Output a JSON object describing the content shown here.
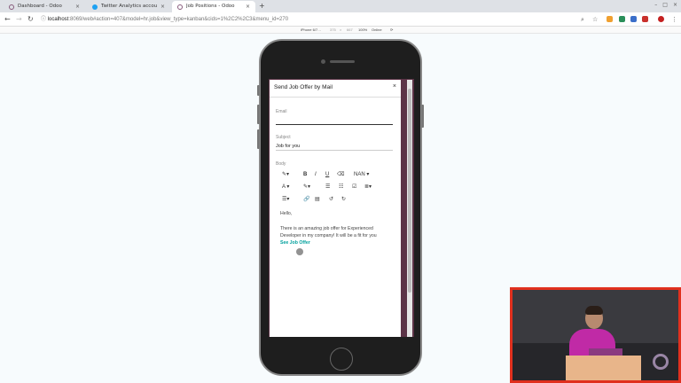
{
  "browser": {
    "tabs": [
      {
        "title": "Dashboard - Odoo",
        "icon": "odoo-icon",
        "color": "#875A7B"
      },
      {
        "title": "Twitter Analytics account ov…",
        "icon": "twitter-icon",
        "color": "#1DA1F2"
      },
      {
        "title": "Job Positions - Odoo",
        "icon": "odoo-icon",
        "color": "#875A7B"
      }
    ],
    "url_host": "localhost",
    "url_path": ":8069/web#action=407&model=hr.job&view_type=kanban&cids=1%2C2%2C3&menu_id=270"
  },
  "devtools": {
    "device": "iPhone 6/7…",
    "width": "375",
    "height": "667",
    "zoom": "100%",
    "throttle": "Online"
  },
  "modal": {
    "title": "Send Job Offer by Mail",
    "close": "×",
    "email_label": "Email",
    "email_value": "",
    "subject_label": "Subject",
    "subject_value": "Job for you",
    "body_label": "Body",
    "toolbar": {
      "style": "✎▾",
      "bold": "B",
      "italic": "I",
      "underline": "U",
      "eraser": "⌫",
      "font_size": "NAN ▾",
      "font_color": "A ▾",
      "highlight": "✎▾",
      "ul": "☰",
      "ol": "☷",
      "checklist": "☑",
      "align": "≣▾",
      "table": "☰▾",
      "link": "🔗",
      "file": "▤",
      "undo": "↺",
      "redo": "↻"
    },
    "body": {
      "greeting": "Hello,",
      "message": "There is an amazing job offer for Experienced Developer in my company! It will be a fit for you",
      "link": "See Job Offer"
    }
  },
  "colors": {
    "accent": "#00A09D",
    "odoo": "#875A7B",
    "cam_border": "#e0301e"
  }
}
